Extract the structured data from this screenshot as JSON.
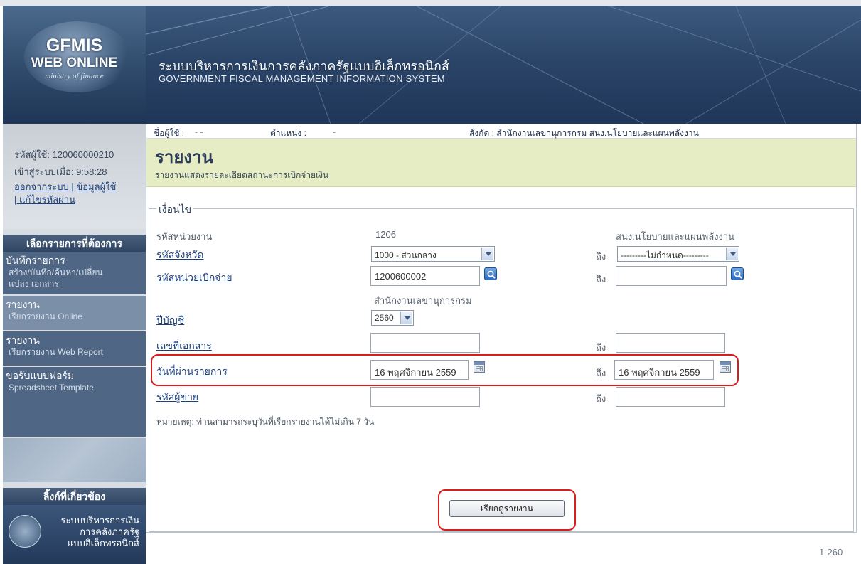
{
  "header": {
    "logo_line1": "GFMIS",
    "logo_line2": "WEB ONLINE",
    "logo_line3": "ministry of finance",
    "system_name_th": "ระบบบริหารการเงินการคลังภาครัฐแบบอิเล็กทรอนิกส์",
    "system_name_en": "GOVERNMENT FISCAL MANAGEMENT INFORMATION SYSTEM"
  },
  "sidebar": {
    "user_code": "รหัสผู้ใช้: 120060000210",
    "login_time": "เข้าสู่ระบบเมื่อ: 9:58:28",
    "links": [
      "ออกจากระบบ | ข้อมูลผู้ใช้",
      "| แก้ไขรหัสผ่าน"
    ],
    "menu_header": "เลือกรายการที่ต้องการ",
    "menu_items": [
      {
        "title": "บันทึกรายการ",
        "sub": "สร้าง/บันทึก/ค้นหา/เปลี่ยน",
        "sub2": "แปลง เอกสาร"
      },
      {
        "title": "รายงาน",
        "sub": "เรียกรายงาน Online"
      },
      {
        "title": "รายงาน",
        "sub": "เรียกรายงาน Web Report"
      },
      {
        "title": "ขอรับแบบฟอร์ม",
        "sub": "Spreadsheet Template"
      }
    ],
    "related_header": "ลิ้งก์ที่เกี่ยวข้อง",
    "related_logo_lines": [
      "ระบบบริหารการเงิน",
      "การคลังภาครัฐ",
      "แบบอิเล็กทรอนิกส์"
    ]
  },
  "info_bar": {
    "user_label": "ชื่อผู้ใช้ :",
    "user_value": "- -",
    "position_label": "ตำแหน่ง :",
    "position_value": "-",
    "affiliation": "สังกัด : สำนักงานเลขานุการกรม สนง.นโยบายและแผนพลังงาน"
  },
  "page": {
    "title": "รายงาน",
    "subtitle": "รายงานแสดงรายละเอียดสถานะการเบิกจ่ายเงิน",
    "legend": "เงื่อนไข"
  },
  "form": {
    "to_label": "ถึง",
    "agency_code_label": "รหัสหน่วยงาน",
    "agency_code_value": "1206",
    "agency_name": "สนง.นโยบายและแผนพลังงาน",
    "province_label": "รหัสจังหวัด",
    "province_value": "1000 - ส่วนกลาง",
    "province_to_value": "---------ไม่กำหนด---------",
    "disburse_unit_label": "รหัสหน่วยเบิกจ่าย",
    "disburse_unit_value": "1200600002",
    "disburse_unit_to_value": "",
    "disburse_unit_name": "สำนักงานเลขานุการกรม",
    "fiscal_year_label": "ปีบัญชี",
    "fiscal_year_value": "2560",
    "doc_no_label": "เลขที่เอกสาร",
    "doc_no_value": "",
    "doc_no_to_value": "",
    "post_date_label": "วันที่ผ่านรายการ",
    "post_date_from": "16 พฤศจิกายน 2559",
    "post_date_to": "16 พฤศจิกายน 2559",
    "vendor_label": "รหัสผู้ขาย",
    "vendor_value": "",
    "vendor_to_value": "",
    "note": "หมายเหตุ: ท่านสามารถระบุวันที่เรียกรายงานได้ไม่เกิน 7 วัน",
    "submit_label": "เรียกดูรายงาน"
  },
  "page_number": "1-260",
  "colors": {
    "accent_highlight": "#d91c1c",
    "title_band": "#e6ecc4",
    "link": "#1b3f7e",
    "banner": "#2b4568"
  }
}
